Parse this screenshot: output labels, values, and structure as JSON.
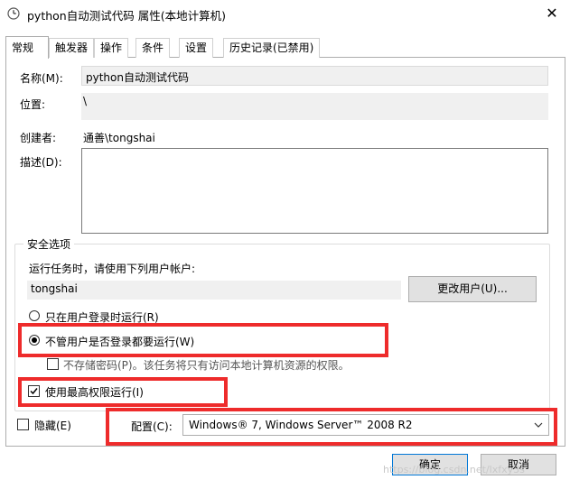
{
  "window": {
    "title": "python自动测试代码 属性(本地计算机)",
    "close_glyph": "✕"
  },
  "tabs": [
    {
      "label": "常规"
    },
    {
      "label": "触发器"
    },
    {
      "label": "操作"
    },
    {
      "label": "条件"
    },
    {
      "label": "设置"
    },
    {
      "label": "历史记录(已禁用)"
    }
  ],
  "general": {
    "name_label": "名称(M):",
    "name_value": "python自动测试代码",
    "location_label": "位置:",
    "location_value": "\\",
    "author_label": "创建者:",
    "author_value": "通善\\tongshai",
    "description_label": "描述(D):",
    "description_value": ""
  },
  "security": {
    "group_title": "安全选项",
    "run_as_prompt": "运行任务时，请使用下列用户帐户:",
    "user_value": "tongshai",
    "change_user_button": "更改用户(U)...",
    "option_logged_on": "只在用户登录时运行(R)",
    "option_whether_logged_on": "不管用户是否登录都要运行(W)",
    "selected_option": "whether_logged_on",
    "no_store_password": "不存储密码(P)。该任务将只有访问本地计算机资源的权限。",
    "no_store_password_checked": false,
    "highest_privileges": "使用最高权限运行(I)",
    "highest_privileges_checked": true
  },
  "bottom": {
    "hidden_label": "隐藏(E)",
    "hidden_checked": false,
    "configure_label": "配置(C):",
    "configure_value": "Windows® 7, Windows Server™ 2008 R2"
  },
  "buttons": {
    "ok": "确定",
    "cancel": "取消"
  },
  "watermark": "https://blog.csdn.net/lxfxy3s",
  "colors": {
    "highlight_box": "#ee2b2b",
    "ok_border": "#0078d7"
  }
}
